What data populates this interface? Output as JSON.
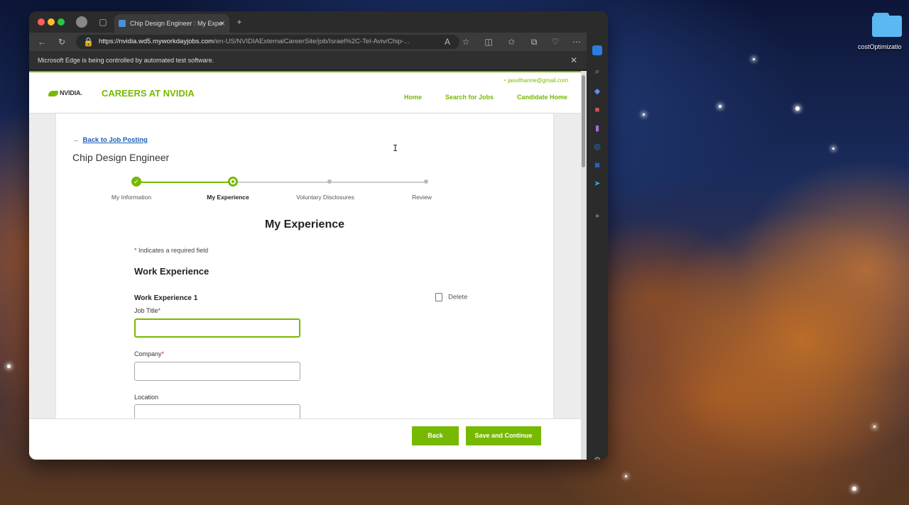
{
  "desktop": {
    "folder_label": "costOptimizatio"
  },
  "browser": {
    "tab_title": "Chip Design Engineer : My Expe",
    "url_host": "https://nvidia.wd5.myworkdayjobs.com",
    "url_path": "/en-US/NVIDIAExternalCareerSite/job/Israel%2C-Tel-Aviv/Chip-...",
    "infobar_text": "Microsoft Edge is being controlled by automated test software."
  },
  "header": {
    "logo": "NVIDIA.",
    "careers_title": "CAREERS AT NVIDIA",
    "user_email": "jasvithanne@gmail.com",
    "nav": [
      "Home",
      "Search for Jobs",
      "Candidate Home"
    ]
  },
  "content": {
    "back_link": "Back to Job Posting",
    "job_title": "Chip Design Engineer",
    "steps": [
      {
        "label": "My Information",
        "state": "done"
      },
      {
        "label": "My Experience",
        "state": "current"
      },
      {
        "label": "Voluntary Disclosures",
        "state": "todo"
      },
      {
        "label": "Review",
        "state": "todo"
      }
    ],
    "section_title": "My Experience",
    "required_note": "Indicates a required field",
    "work_experience_heading": "Work Experience",
    "work_experience_item": "Work Experience 1",
    "delete_label": "Delete",
    "fields": {
      "job_title": {
        "label": "Job Title",
        "value": ""
      },
      "company": {
        "label": "Company",
        "value": ""
      },
      "location": {
        "label": "Location",
        "value": ""
      }
    }
  },
  "footer": {
    "back_button": "Back",
    "save_button": "Save and Continue"
  },
  "colors": {
    "accent": "#76b900",
    "link": "#1a5fb4",
    "required": "#c62828"
  }
}
